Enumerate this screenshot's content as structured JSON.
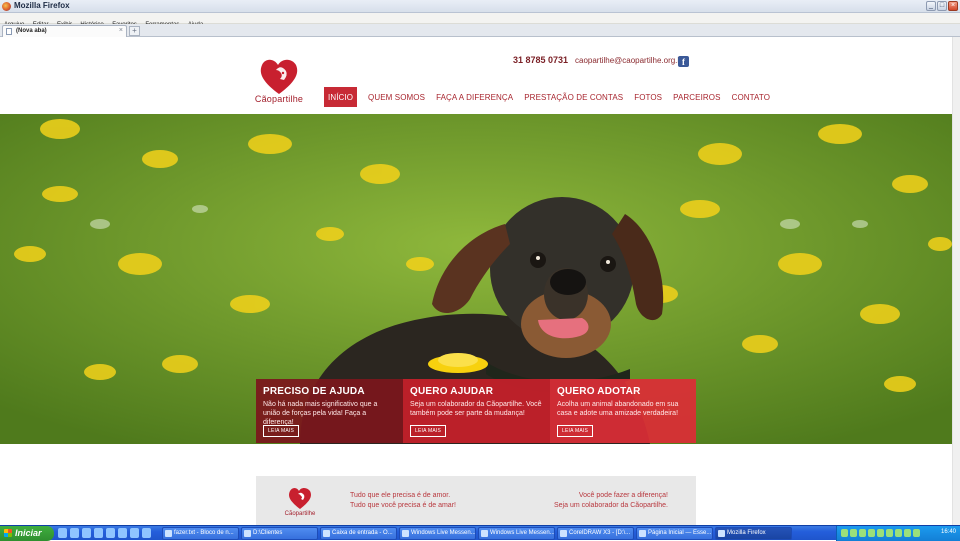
{
  "window": {
    "title": "Mozilla Firefox",
    "controls": [
      "_",
      "□",
      "×"
    ]
  },
  "menubar": {
    "items": [
      "Arquivo",
      "Editar",
      "Exibir",
      "Histórico",
      "Favoritos",
      "Ferramentas",
      "Ajuda"
    ]
  },
  "tabs": [
    {
      "label": "(Nova aba)",
      "active": true
    }
  ],
  "new_tab_label": "+",
  "site": {
    "logo_text": "Cãopartilhe",
    "phone": "31 8785 0731",
    "email": "caopartilhe@caopartilhe.org.br",
    "facebook_label": "f",
    "nav": [
      "INÍCIO",
      "QUEM SOMOS",
      "FAÇA A DIFERENÇA",
      "PRESTAÇÃO DE CONTAS",
      "FOTOS",
      "PARCEIROS",
      "CONTATO"
    ],
    "nav_active": "INÍCIO",
    "cards": [
      {
        "title": "PRECISO DE AJUDA",
        "text": "Não há nada mais significativo que a união de forças pela vida! Faça a diferença!",
        "button": "LEIA MAIS"
      },
      {
        "title": "QUERO AJUDAR",
        "text": "Seja um colaborador da Cãopartilhe. Você também pode ser parte da mudança!",
        "button": "LEIA MAIS"
      },
      {
        "title": "QUERO ADOTAR",
        "text": "Acolha um animal abandonado em sua casa e adote uma amizade verdadeira!",
        "button": "LEIA MAIS"
      }
    ],
    "footer": {
      "logo_text": "Cãopartilhe",
      "left_line1": "Tudo que ele precisa é de amor.",
      "left_line2": "Tudo que você precisa é de amar!",
      "right_line1": "Você pode fazer a diferença!",
      "right_line2": "Seja um colaborador da Cãopartilhe."
    }
  },
  "colors": {
    "brand_red": "#c72a35",
    "dark_red": "#7c161c",
    "taskbar_blue": "#245edb",
    "start_green": "#3fae3f"
  },
  "taskbar": {
    "start_label": "Iniciar",
    "tasks": [
      {
        "label": "fazer.txt - Bloco de n...",
        "active": false
      },
      {
        "label": "D:\\Clientes",
        "active": false
      },
      {
        "label": "Caixa de entrada - O...",
        "active": false
      },
      {
        "label": "Windows Live Messen...",
        "active": false
      },
      {
        "label": "Windows Live Messen...",
        "active": false
      },
      {
        "label": "CorelDRAW X3 - [D:\\...",
        "active": false
      },
      {
        "label": "Página Inicial — Esse...",
        "active": false
      },
      {
        "label": "Mozilla Firefox",
        "active": true
      }
    ],
    "clock": "16:40"
  }
}
